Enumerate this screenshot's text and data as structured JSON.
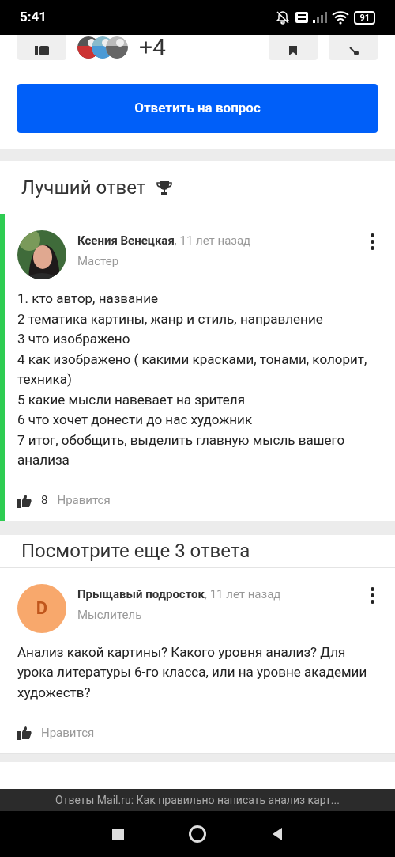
{
  "status_bar": {
    "time": "5:41",
    "battery": "91"
  },
  "question_actions": {
    "others_count": "+4"
  },
  "answer_button": {
    "label": "Ответить на вопрос"
  },
  "best_answer": {
    "title": "Лучший ответ",
    "answer": {
      "author": "Ксения Венецкая",
      "time": ", 11 лет назад",
      "rank": "Мастер",
      "lines": [
        "1. кто автор, название",
        "2 тематика картины, жанр и стиль, направление",
        "3 что изображено",
        "4 как изображено ( какими красками, тонами, колорит, техника)",
        "5 какие мысли навевает на зрителя",
        "6 что хочет донести до нас художник",
        "7 итог, обобщить, выделить главную мысль вашего анализа"
      ],
      "likes": "8",
      "like_label": "Нравится"
    }
  },
  "more_answers": {
    "title": "Посмотрите еще 3 ответа",
    "answers": [
      {
        "author": "Прыщавый подросток",
        "time": ", 11 лет назад",
        "rank": "Мыслитель",
        "avatar": {
          "kind": "letter",
          "letter": "D",
          "color": "#f8a86c"
        },
        "lines": [
          "Анализ какой картины? Какого уровня анализ? Для урока литературы 6-го класса, или на уровне академии художеств?"
        ],
        "like_label": "Нравится"
      }
    ]
  },
  "page_caption": "Ответы Mail.ru: Как правильно написать анализ карт..."
}
